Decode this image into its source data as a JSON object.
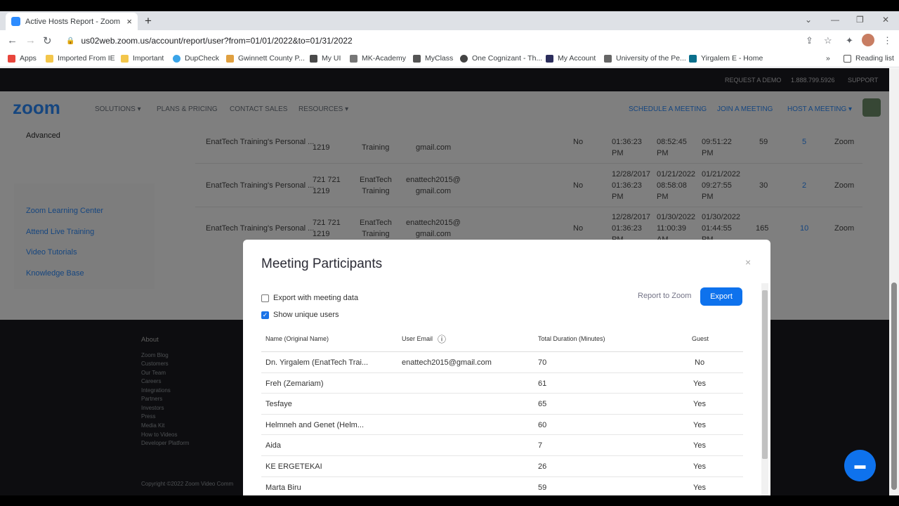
{
  "browser": {
    "tab_title": "Active Hosts Report - Zoom",
    "tab_close": "×",
    "new_tab": "+",
    "url": "us02web.zoom.us/account/report/user?from=01/01/2022&to=01/31/2022",
    "bookmarks": [
      "Apps",
      "Imported From IE",
      "Important",
      "DupCheck",
      "Gwinnett County P...",
      "My UI",
      "MK-Academy",
      "MyClass",
      "One Cognizant - Th...",
      "My Account",
      "University of the Pe...",
      "Yirgalem E - Home"
    ],
    "more_bookmarks": "»",
    "reading_list": "Reading list"
  },
  "topstrip": {
    "request_demo": "REQUEST A DEMO",
    "phone": "1.888.799.5926",
    "support": "SUPPORT"
  },
  "navbar": {
    "logo": "zoom",
    "left": [
      "SOLUTIONS ▾",
      "PLANS & PRICING",
      "CONTACT SALES",
      "RESOURCES ▾"
    ],
    "right": [
      "SCHEDULE A MEETING",
      "JOIN A MEETING",
      "HOST A MEETING ▾"
    ]
  },
  "sidebar": {
    "advanced": "Advanced",
    "links": [
      "Zoom Learning Center",
      "Attend Live Training",
      "Video Tutorials",
      "Knowledge Base"
    ]
  },
  "host_rows": [
    {
      "topic": "EnatTech Training's Personal ...",
      "id": [
        "",
        "1219"
      ],
      "host": [
        "",
        "Training"
      ],
      "email": [
        "",
        "gmail.com"
      ],
      "no": "No",
      "start": [
        "01:36:23",
        "PM"
      ],
      "mstart": [
        "08:52:45",
        "PM"
      ],
      "mend": [
        "09:51:22",
        "PM"
      ],
      "dur": "59",
      "part": "5",
      "src": "Zoom"
    },
    {
      "topic": "EnatTech Training's Personal ...",
      "id": [
        "721 721",
        "1219"
      ],
      "host": [
        "EnatTech",
        "Training"
      ],
      "email": [
        "enattech2015@",
        "gmail.com"
      ],
      "no": "No",
      "start": [
        "12/28/2017",
        "01:36:23",
        "PM"
      ],
      "mstart": [
        "01/21/2022",
        "08:58:08",
        "PM"
      ],
      "mend": [
        "01/21/2022",
        "09:27:55",
        "PM"
      ],
      "dur": "30",
      "part": "2",
      "src": "Zoom"
    },
    {
      "topic": "EnatTech Training's Personal ...",
      "id": [
        "721 721",
        "1219"
      ],
      "host": [
        "EnatTech",
        "Training"
      ],
      "email": [
        "enattech2015@",
        "gmail.com"
      ],
      "no": "No",
      "start": [
        "12/28/2017",
        "01:36:23",
        "PM"
      ],
      "mstart": [
        "01/30/2022",
        "11:00:39",
        "AM"
      ],
      "mend": [
        "01/30/2022",
        "01:44:55",
        "PM"
      ],
      "dur": "165",
      "part": "10",
      "src": "Zoom"
    }
  ],
  "footer": {
    "heading": "About",
    "links": [
      "Zoom Blog",
      "Customers",
      "Our Team",
      "Careers",
      "Integrations",
      "Partners",
      "Investors",
      "Press",
      "Media Kit",
      "How to Videos",
      "Developer Platform"
    ],
    "copyright": "Copyright ©2022 Zoom Video Comm"
  },
  "modal": {
    "title": "Meeting Participants",
    "close": "×",
    "export_with_meeting": "Export with meeting data",
    "show_unique": "Show unique users",
    "report_to_zoom": "Report to Zoom",
    "export": "Export",
    "columns": [
      "Name (Original Name)",
      "User Email",
      "Total Duration (Minutes)",
      "Guest"
    ],
    "rows": [
      {
        "name": "Dn. Yirgalem (EnatTech Trai...",
        "email": "enattech2015@gmail.com",
        "duration": "70",
        "guest": "No"
      },
      {
        "name": "Freh (Zemariam)",
        "email": "",
        "duration": "61",
        "guest": "Yes"
      },
      {
        "name": "Tesfaye",
        "email": "",
        "duration": "65",
        "guest": "Yes"
      },
      {
        "name": "Helmneh and Genet (Helm...",
        "email": "",
        "duration": "60",
        "guest": "Yes"
      },
      {
        "name": "Aida",
        "email": "",
        "duration": "7",
        "guest": "Yes"
      },
      {
        "name": "KE ERGETEKAI",
        "email": "",
        "duration": "26",
        "guest": "Yes"
      },
      {
        "name": "Marta Biru",
        "email": "",
        "duration": "59",
        "guest": "Yes"
      }
    ]
  },
  "colors": {
    "accent": "#2d8cff",
    "export_button": "#0e72ed"
  }
}
